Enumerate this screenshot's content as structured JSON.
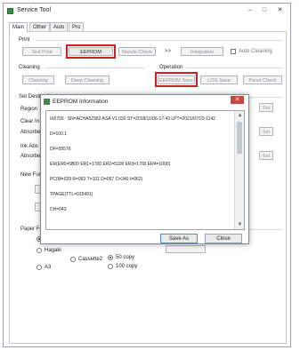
{
  "window": {
    "title": "Service Tool",
    "controls": {
      "minimize": "–",
      "maximize": "□",
      "close": "✕"
    }
  },
  "tabs": [
    "Main",
    "Other",
    "Auto",
    "Pro"
  ],
  "print": {
    "section": "Print",
    "test_print": "Test Print",
    "eeprom": "EEPROM",
    "nozzle_check": "Nozzle Check",
    "arrows": ">>",
    "integration": "Integration",
    "auto_cleaning": "Auto Cleaning"
  },
  "cleaning": {
    "section": "Cleaning",
    "cleaning": "Cleaning",
    "deep_cleaning": "Deep Cleaning"
  },
  "operation": {
    "section": "Operation",
    "eeprom_save": "EEPROM Save",
    "log_save": "LOG Save",
    "panel_check": "Panel Check"
  },
  "set_destination": {
    "section": "Set Destination",
    "region": "Region",
    "set": "Set"
  },
  "clear_ink": {
    "section": "Clear In",
    "absorber": "Absorbe",
    "set": "Set"
  },
  "ink_absorber": {
    "section": "Ink Abs",
    "absorber": "Absorbe",
    "set": "Set"
  },
  "new_function": {
    "section": "New Func"
  },
  "paper_feed": {
    "section": "Paper Fe",
    "options": [
      "Hagaki",
      "Cassette2",
      "A3"
    ],
    "copies": [
      "50 copy",
      "100 copy"
    ]
  },
  "dialog": {
    "title": "EEPROM Information",
    "close": "✕",
    "lines": [
      "iX6700   SN=ACHA52362 ASA V1.030 ST=2018/11/06-17:43 LPT=2021/07/23-1142",
      "D=100.1",
      "DF=55576",
      "ER(ER0=5B00 ER1=1700 ER2=5100 ER3=1700 ER4=1000)",
      "PC(M=029 R=063 T=101 D=057 C=240 I=062)",
      "TPAGE(TTL=015491)",
      "CH=043"
    ],
    "save_as": "Save As",
    "close_button": "Close"
  }
}
